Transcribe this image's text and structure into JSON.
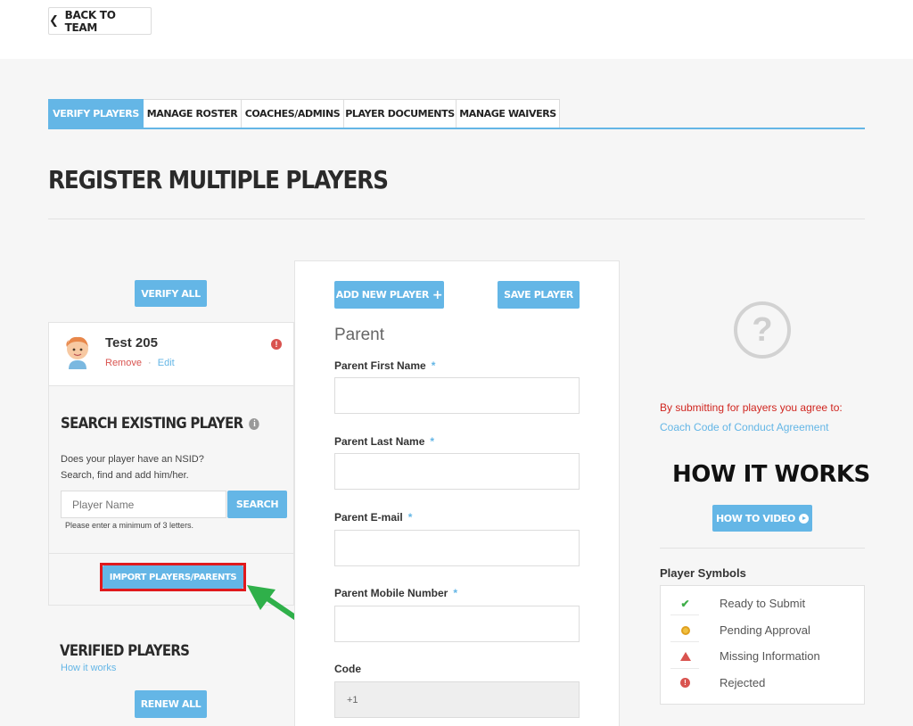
{
  "header": {
    "back_label": "BACK TO TEAM",
    "back_icon": "chevron-left-icon"
  },
  "tabs": [
    {
      "label": "VERIFY PLAYERS",
      "active": true
    },
    {
      "label": "MANAGE ROSTER",
      "active": false
    },
    {
      "label": "COACHES/ADMINS",
      "active": false
    },
    {
      "label": "PLAYER DOCUMENTS",
      "active": false
    },
    {
      "label": "MANAGE WAIVERS",
      "active": false
    }
  ],
  "page_title": "REGISTER MULTIPLE PLAYERS",
  "left": {
    "verify_all_label": "VERIFY ALL",
    "player": {
      "name": "Test 205",
      "remove_label": "Remove",
      "separator": "·",
      "edit_label": "Edit",
      "status_icon": "error-icon",
      "status_glyph": "!"
    },
    "search": {
      "title": "SEARCH EXISTING PLAYER",
      "info_glyph": "i",
      "desc_line1": "Does your player have an NSID?",
      "desc_line2": "Search, find and add him/her.",
      "placeholder": "Player Name",
      "button_label": "SEARCH",
      "hint": "Please enter a minimum of 3 letters."
    },
    "import_label": "IMPORT PLAYERS/PARENTS",
    "verified": {
      "title": "VERIFIED PLAYERS",
      "link": "How it works",
      "renew_label": "RENEW ALL"
    }
  },
  "form": {
    "add_player_label": "ADD NEW PLAYER",
    "add_player_icon": "+",
    "save_player_label": "SAVE PLAYER",
    "section": "Parent",
    "required_mark": "*",
    "fields": [
      {
        "label": "Parent First Name",
        "value": ""
      },
      {
        "label": "Parent Last Name",
        "value": ""
      },
      {
        "label": "Parent E-mail",
        "value": ""
      },
      {
        "label": "Parent Mobile Number",
        "value": ""
      }
    ],
    "code_label": "Code",
    "code_value": "+1"
  },
  "right": {
    "help_glyph": "?",
    "agree_text": "By submitting for players you agree to:",
    "coach_link": "Coach Code of Conduct Agreement",
    "how_title": "HOW IT WORKS",
    "video_label": "HOW TO VIDEO",
    "symbols_title": "Player Symbols",
    "symbols": [
      {
        "label": "Ready to Submit",
        "icon": "check-icon",
        "glyph": "✔"
      },
      {
        "label": "Pending Approval",
        "icon": "pending-icon",
        "glyph": ""
      },
      {
        "label": "Missing Information",
        "icon": "warning-icon",
        "glyph": ""
      },
      {
        "label": "Rejected",
        "icon": "rejected-icon",
        "glyph": "!"
      }
    ]
  },
  "colors": {
    "accent": "#64b6e6",
    "danger": "#d9534f",
    "highlight_border": "#e0191c",
    "arrow": "#2fb04a"
  }
}
